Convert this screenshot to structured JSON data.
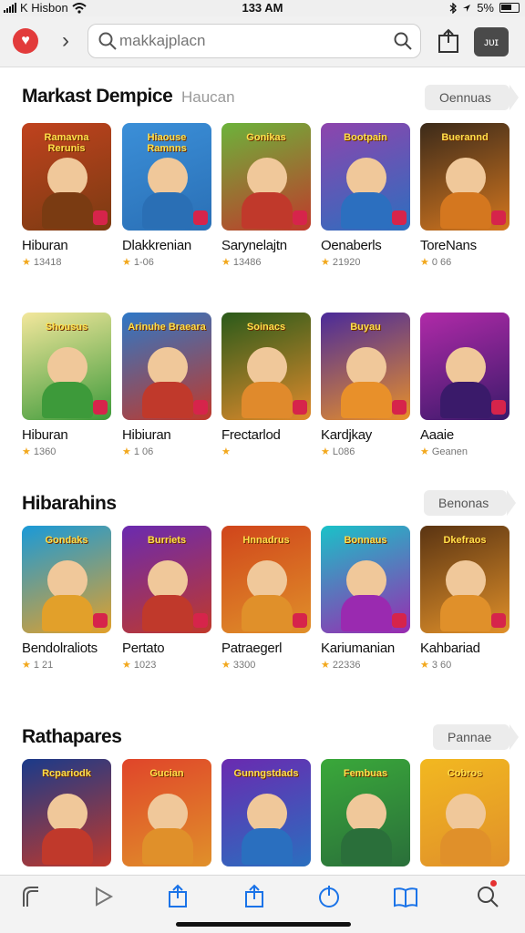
{
  "status_bar": {
    "carrier": "K Hisbon",
    "time": "133 AM",
    "battery": "5%"
  },
  "toolbar": {
    "search_placeholder": "makkajplacn",
    "account_label": "ᴊᴜɪ"
  },
  "sections": [
    {
      "title": "Markast Dempice",
      "subtitle": "Haucan",
      "pill": "Oennuas"
    },
    {
      "title": "Hibarahins",
      "pill": "Benonas"
    },
    {
      "title": "Rathapares",
      "pill": "Pannae"
    }
  ],
  "rows": [
    {
      "items": [
        {
          "name": "Hiburan",
          "rating": "13418",
          "art": "Ramavna Rerunis",
          "bg": "#c0421e",
          "accent": "#7a3b12"
        },
        {
          "name": "Dlakkrenian",
          "rating": "1-06",
          "art": "Hiaouse Ramnns",
          "bg": "#3b8fd8",
          "accent": "#2a6fb5"
        },
        {
          "name": "Sarynelajtn",
          "rating": "13486",
          "art": "Gonikas",
          "bg": "#6cb33b",
          "accent": "#c0392b"
        },
        {
          "name": "Oenaberls",
          "rating": "21920",
          "art": "Bootpain",
          "bg": "#8e44ad",
          "accent": "#2c6fbf"
        },
        {
          "name": "ToreNans",
          "rating": "0 66",
          "art": "Buerannd",
          "bg": "#3b2a1a",
          "accent": "#d4771f"
        }
      ]
    },
    {
      "items": [
        {
          "name": "Hiburan",
          "rating": "1360",
          "art": "Shousus",
          "bg": "#f3e79c",
          "accent": "#3d9a3a"
        },
        {
          "name": "Hibiuran",
          "rating": "1 06",
          "art": "Arinuhe Braeara",
          "bg": "#2e78c7",
          "accent": "#c0392b"
        },
        {
          "name": "Frectarlod",
          "rating": "",
          "art": "Soinacs",
          "bg": "#2a5a1a",
          "accent": "#e08a2c"
        },
        {
          "name": "Kardjkay",
          "rating": "L086",
          "art": "Buyau",
          "bg": "#4a2a9a",
          "accent": "#e8902a"
        },
        {
          "name": "Aaaie",
          "rating": "Geanen",
          "art": "",
          "bg": "#b02aa8",
          "accent": "#3a1a6a"
        }
      ]
    },
    {
      "items": [
        {
          "name": "Bendolraliots",
          "rating": "1 21",
          "art": "Gondaks",
          "bg": "#1a9ad8",
          "accent": "#e2a02a"
        },
        {
          "name": "Pertato",
          "rating": "1023",
          "art": "Burriets",
          "bg": "#6a2ab0",
          "accent": "#c0392b"
        },
        {
          "name": "Patraegerl",
          "rating": "3300",
          "art": "Hnnadrus",
          "bg": "#d0451b",
          "accent": "#e0902a"
        },
        {
          "name": "Kariumanian",
          "rating": "22336",
          "art": "Bonnaus",
          "bg": "#1ac2c8",
          "accent": "#9a2ab0"
        },
        {
          "name": "Kahbariad",
          "rating": "3 60",
          "art": "Dkefraos",
          "bg": "#5a3412",
          "accent": "#e0902a"
        }
      ]
    },
    {
      "items": [
        {
          "name": "",
          "rating": "",
          "art": "Rcpariodk",
          "bg": "#1a3a8a",
          "accent": "#c0392b"
        },
        {
          "name": "",
          "rating": "",
          "art": "Gucian",
          "bg": "#e0452a",
          "accent": "#e0902a"
        },
        {
          "name": "",
          "rating": "",
          "art": "Gunngstdads",
          "bg": "#6a2ab0",
          "accent": "#2a6fbf"
        },
        {
          "name": "",
          "rating": "",
          "art": "Fembuas",
          "bg": "#3aa83a",
          "accent": "#2a6f3a"
        },
        {
          "name": "",
          "rating": "",
          "art": "Cobros",
          "bg": "#f2b820",
          "accent": "#e0902a"
        }
      ]
    }
  ],
  "tabs": [
    "back-icon",
    "play-icon",
    "share-icon",
    "upload-icon",
    "power-icon",
    "book-icon",
    "search-icon"
  ]
}
